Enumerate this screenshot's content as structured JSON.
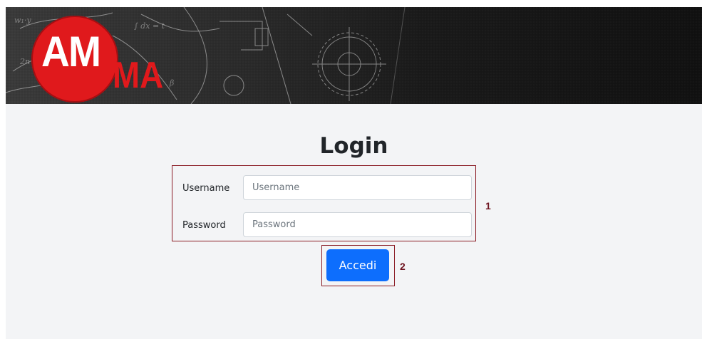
{
  "header": {
    "logo_primary": "AM",
    "logo_secondary": "MA",
    "brand_color": "#e0191c"
  },
  "login": {
    "title": "Login",
    "username": {
      "label": "Username",
      "placeholder": "Username",
      "value": ""
    },
    "password": {
      "label": "Password",
      "placeholder": "Password",
      "value": ""
    },
    "submit_label": "Accedi",
    "submit_color": "#0d6efd"
  },
  "annotations": {
    "marker_1": "1",
    "marker_2": "2",
    "highlight_color": "#8a1b24"
  }
}
